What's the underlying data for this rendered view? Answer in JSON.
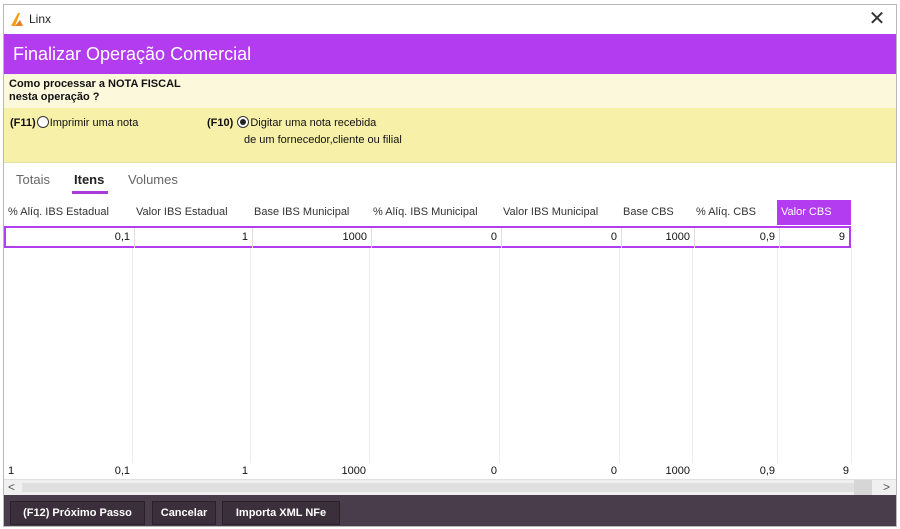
{
  "window": {
    "title": "Linx",
    "close_glyph": "✕"
  },
  "header": {
    "title": "Finalizar Operação Comercial"
  },
  "question": {
    "line1": "Como processar a NOTA FISCAL",
    "line2": "nesta operação ?"
  },
  "options": [
    {
      "key": "(F11)",
      "label": "Imprimir uma nota",
      "checked": false
    },
    {
      "key": "(F10)",
      "label_line1": "Digitar uma nota recebida",
      "label_line2": "de um fornecedor,cliente ou filial",
      "checked": true
    }
  ],
  "tabs": [
    {
      "label": "Totais",
      "active": false
    },
    {
      "label": "Itens",
      "active": true
    },
    {
      "label": "Volumes",
      "active": false
    }
  ],
  "grid": {
    "columns": [
      "% Alíq. IBS Estadual",
      "Valor IBS Estadual",
      "Base IBS Municipal",
      "% Alíq. IBS Municipal",
      "Valor IBS Municipal",
      "Base CBS",
      "% Alíq. CBS",
      "Valor CBS"
    ],
    "active_column": "Valor CBS",
    "rows": [
      [
        "0,1",
        "1",
        "1000",
        "0",
        "0",
        "1000",
        "0,9",
        "9"
      ]
    ],
    "totals": {
      "count": "1",
      "values": [
        "0,1",
        "1",
        "1000",
        "0",
        "0",
        "1000",
        "0,9",
        "9"
      ]
    }
  },
  "scrollbar": {
    "left_arrow": "<",
    "right_arrow": ">"
  },
  "footer": {
    "buttons": [
      {
        "label": "(F12) Próximo Passo"
      },
      {
        "label": "Cancelar"
      },
      {
        "label": "Importa XML NFe"
      }
    ]
  },
  "colors": {
    "accent": "#b33cf0",
    "question_bg": "#fcf8dc",
    "options_bg": "#f7f0a9",
    "footer_bg": "#4a3d4b",
    "logo_orange": "#f39c12"
  },
  "icons": {
    "logo": "linx-logo-icon",
    "close": "close-icon",
    "radio": "radio-icon"
  }
}
